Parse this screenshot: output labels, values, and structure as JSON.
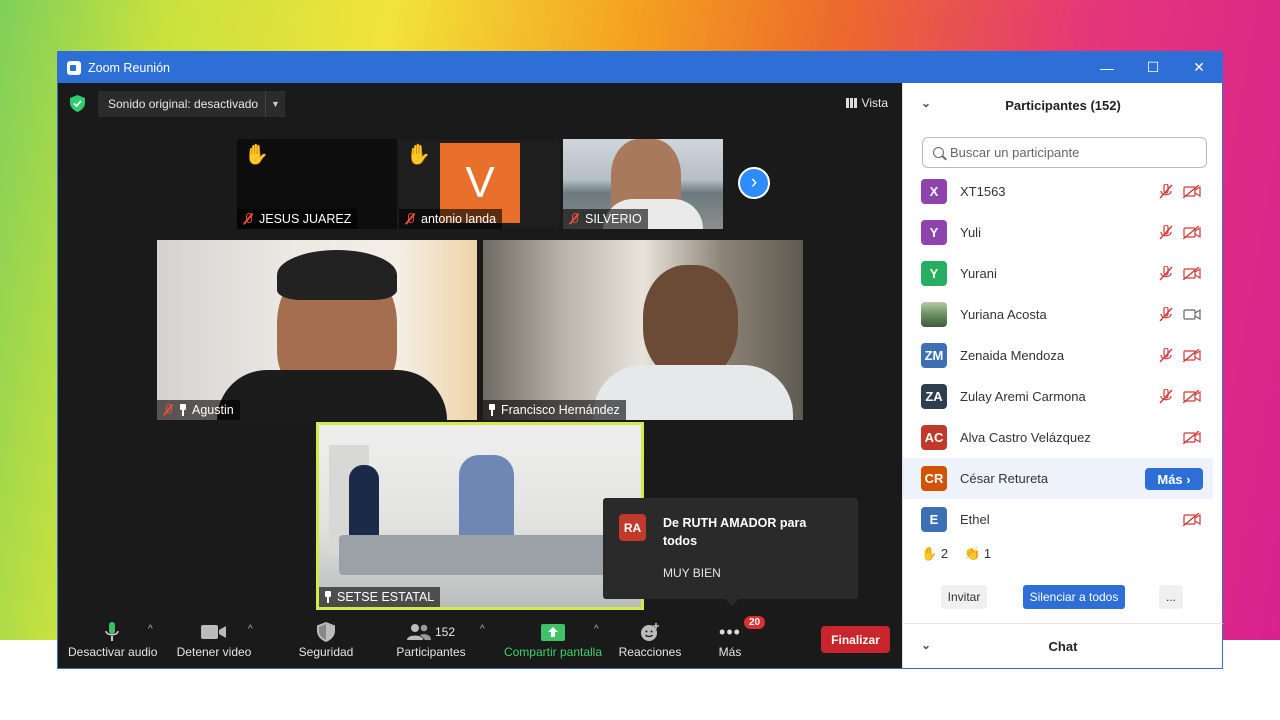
{
  "window": {
    "title": "Zoom Reunión",
    "minimize": "—",
    "maximize": "☐",
    "close": "✕"
  },
  "topbar": {
    "audio_label": "Sonido original: desactivado",
    "view_label": "Vista"
  },
  "tiles": {
    "jesus": "JESUS JUAREZ",
    "antonio": "antonio landa",
    "antonio_initial": "V",
    "silverio": "SILVERIO",
    "agustin": "Agustin",
    "francisco": "Francisco Hernández",
    "setse": "SETSE ESTATAL"
  },
  "notification": {
    "avatar": "RA",
    "from": "De RUTH AMADOR para todos",
    "message": "MUY BIEN"
  },
  "toolbar": {
    "mute": "Desactivar audio",
    "video": "Detener video",
    "security": "Seguridad",
    "participants": "Participantes",
    "participants_count": "152",
    "share": "Compartir pantalla",
    "reactions": "Reacciones",
    "more": "Más",
    "more_badge": "20",
    "end": "Finalizar"
  },
  "panel": {
    "title": "Participantes (152)",
    "search_placeholder": "Buscar un participante",
    "participants": [
      {
        "initials": "X",
        "name": "XT1563",
        "color": "#8e44ad"
      },
      {
        "initials": "Y",
        "name": "Yuli",
        "color": "#8e44ad"
      },
      {
        "initials": "Y",
        "name": "Yurani",
        "color": "#27ae60"
      },
      {
        "initials": "",
        "name": "Yuriana Acosta",
        "color": "#6a8f63"
      },
      {
        "initials": "ZM",
        "name": "Zenaida Mendoza",
        "color": "#3d6fb5"
      },
      {
        "initials": "ZA",
        "name": "Zulay Aremi Carmona",
        "color": "#2c3e50"
      },
      {
        "initials": "AC",
        "name": "Alva Castro Velázquez",
        "color": "#c0392b"
      },
      {
        "initials": "CR",
        "name": "César Retureta",
        "color": "#d35400"
      },
      {
        "initials": "E",
        "name": "Ethel",
        "color": "#3d6fb5"
      }
    ],
    "more_button": "Más",
    "raised_hands": "2",
    "claps": "1",
    "invite": "Invitar",
    "mute_all": "Silenciar a todos",
    "ellipsis": "...",
    "chat": "Chat"
  },
  "colors": {
    "accent": "#2d6fd6",
    "end": "#c8262c",
    "share": "#2ecc71"
  }
}
